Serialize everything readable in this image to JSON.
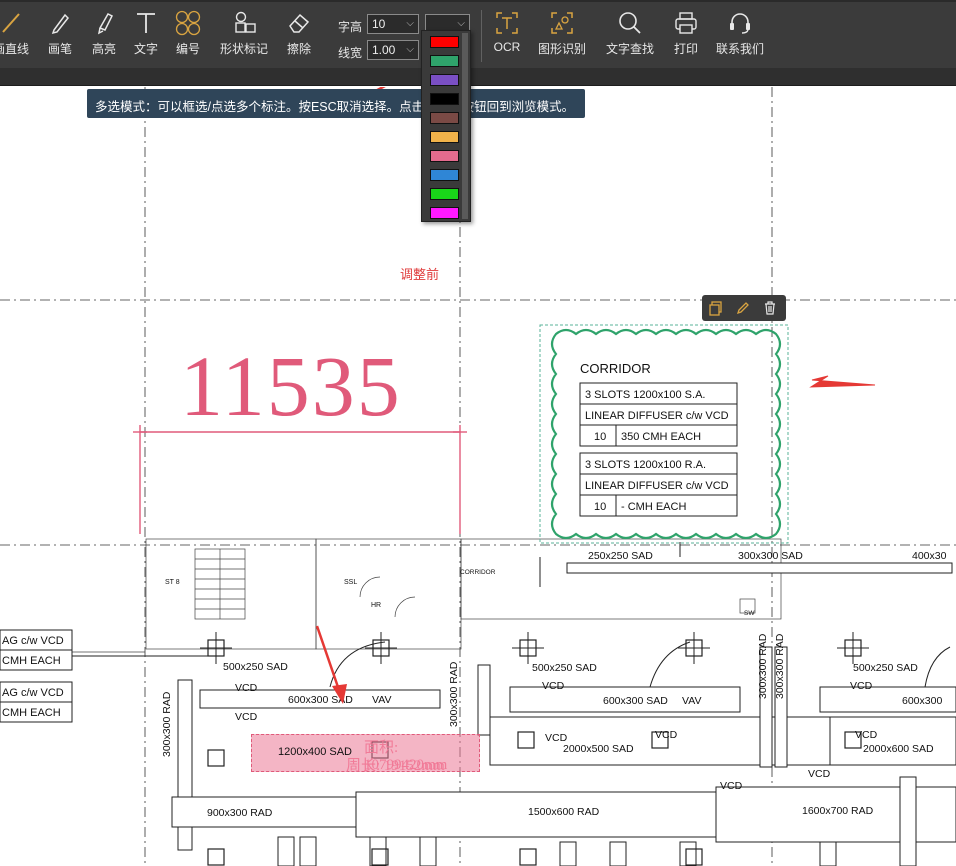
{
  "toolbar": {
    "tools": [
      {
        "id": "line",
        "label": "画直线"
      },
      {
        "id": "pen",
        "label": "画笔"
      },
      {
        "id": "highlight",
        "label": "高亮"
      },
      {
        "id": "text",
        "label": "文字"
      },
      {
        "id": "number",
        "label": "编号"
      },
      {
        "id": "shape-mark",
        "label": "形状标记"
      },
      {
        "id": "erase",
        "label": "擦除"
      },
      {
        "id": "ocr",
        "label": "OCR"
      },
      {
        "id": "shape-recognize",
        "label": "图形识别"
      },
      {
        "id": "text-search",
        "label": "文字查找"
      },
      {
        "id": "print",
        "label": "打印"
      },
      {
        "id": "contact",
        "label": "联系我们"
      }
    ],
    "font_size_label": "字高",
    "font_size_value": "10",
    "line_width_label": "线宽",
    "line_width_value": "1.00"
  },
  "color_options": [
    "#ff0000",
    "#2fa36b",
    "#7a4fc4",
    "#000000",
    "#7a4a45",
    "#f0b24a",
    "#e36b8e",
    "#2f86d6",
    "#19d619",
    "#ff19ff"
  ],
  "tooltip": {
    "text": "多选模式：可以框选/点选多个标注。按ESC取消选择。点击工具栏按钮回到浏览模式。"
  },
  "canvas": {
    "note": "调整前",
    "dimension_value": "11535",
    "corridor": {
      "title": "CORRIDOR",
      "rows": [
        "3 SLOTS 1200x100 S.A.",
        "LINEAR DIFFUSER c/w VCD",
        "350 CMH EACH",
        "3 SLOTS 1200x100 R.A.",
        "LINEAR DIFFUSER c/w VCD",
        "- CMH EACH"
      ],
      "qty1": "10",
      "qty2": "10"
    },
    "duct_labels": {
      "d1": "250x250 SAD",
      "d2": "300x300 SAD",
      "d3": "400x30",
      "d4": "500x250 SAD",
      "d5": "500x250 SAD",
      "d6": "500x250 SAD",
      "d7": "600x300 SAD",
      "d8": "600x300 SAD",
      "d9": "600x300",
      "d10": "1200x400 SAD",
      "d11": "2000x500 SAD",
      "d12": "2000x600 SAD",
      "d13": "900x300 RAD",
      "d14": "1500x600 RAD",
      "d15": "1600x700 RAD",
      "d16": "300x300 RAD",
      "d17": "300x300 RAD",
      "d18": "300x300 RAD",
      "d19": "300x300 RAD",
      "vcd": "VCD",
      "vav": "VAV"
    },
    "room_labels": {
      "st": "ST 8",
      "ssl": "SSL",
      "hr": "HR",
      "corr": "CORRIDOR",
      "sw": "SW"
    },
    "left_labels": [
      "AG c/w VCD",
      "CMH EACH",
      "AG c/w VCD",
      "CMH EACH"
    ],
    "measure": {
      "area": "面积: 10799420mm",
      "perimeter": "周长: 19152mm"
    }
  }
}
